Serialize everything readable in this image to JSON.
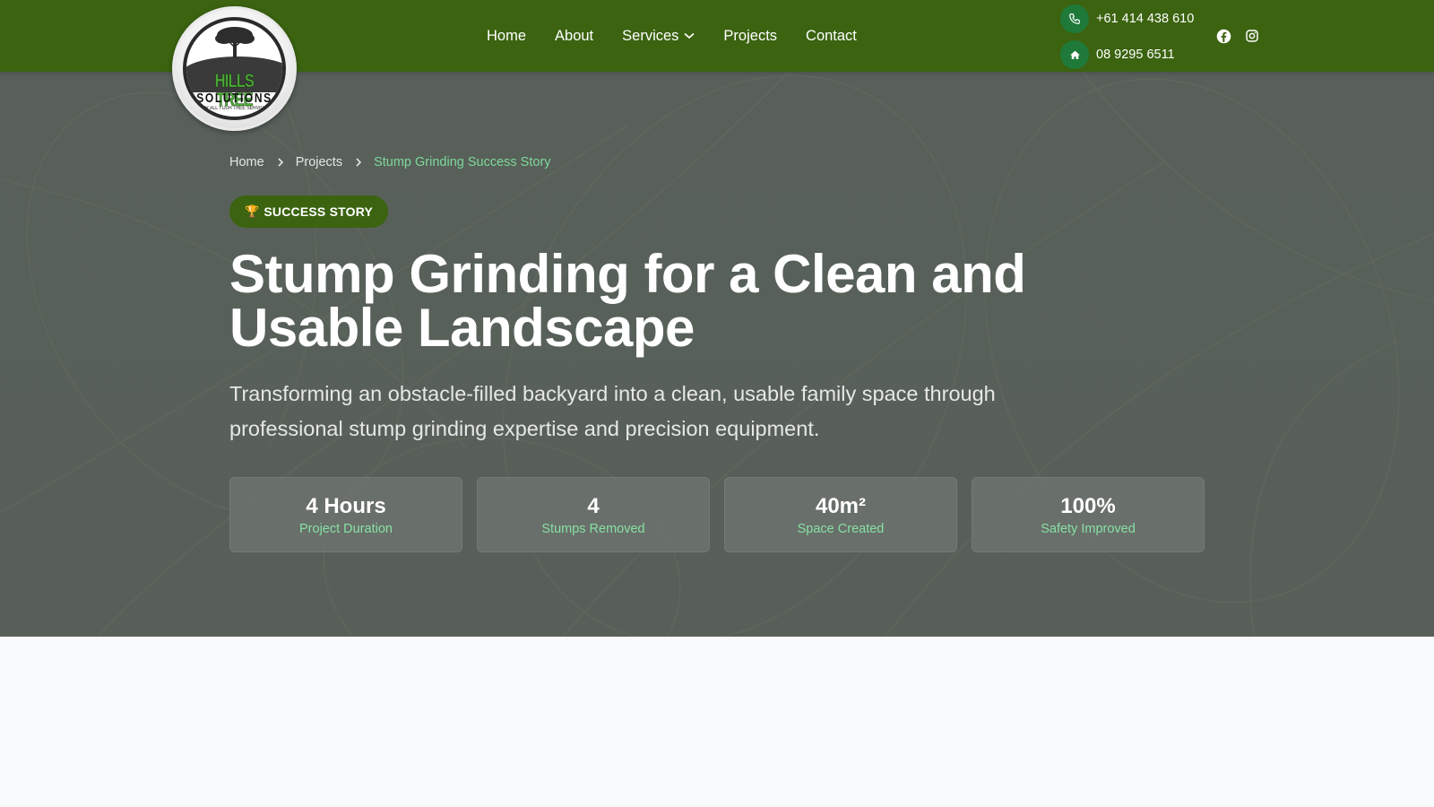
{
  "brand": {
    "logo_line1": "HILLS TREE",
    "logo_line2": "SOLUTIONS",
    "logo_line3": "FOR ALL YOUR TREE SERVICES"
  },
  "nav": {
    "items": [
      {
        "label": "Home"
      },
      {
        "label": "About"
      },
      {
        "label": "Services",
        "has_dropdown": true
      },
      {
        "label": "Projects"
      },
      {
        "label": "Contact"
      }
    ]
  },
  "contact": {
    "phone_mobile": "+61 414 438 610",
    "phone_home": "08 9295 6511",
    "phone_icon": "phone-icon",
    "home_icon": "home-icon"
  },
  "social": {
    "icons": [
      "facebook-icon",
      "instagram-icon"
    ]
  },
  "breadcrumb": {
    "items": [
      "Home",
      "Projects"
    ],
    "current": "Stump Grinding Success Story"
  },
  "hero": {
    "badge_icon": "🏆",
    "badge_label": "SUCCESS STORY",
    "title": "Stump Grinding for a Clean and Usable Landscape",
    "subtitle": "Transforming an obstacle-filled backyard into a clean, usable family space through professional stump grinding expertise and precision equipment."
  },
  "stats": [
    {
      "value": "4 Hours",
      "label": "Project Duration"
    },
    {
      "value": "4",
      "label": "Stumps Removed"
    },
    {
      "value": "40m²",
      "label": "Space Created"
    },
    {
      "value": "100%",
      "label": "Safety Improved"
    }
  ],
  "colors": {
    "header_bg": "#3b6310",
    "accent_green": "#7ed89a",
    "contact_icon_bg": "#1f7a3a",
    "page_bg": "#f8fafc"
  }
}
